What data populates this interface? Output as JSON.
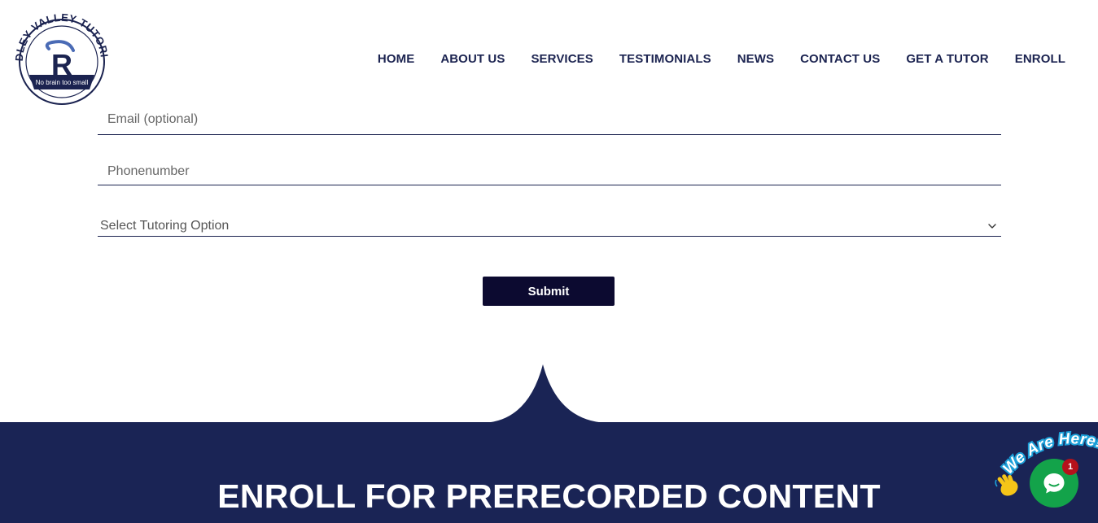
{
  "brand": {
    "name": "RIDLEY VALLEY TUTORIAL",
    "monogram": "R",
    "tagline": "No brain too small",
    "colors": {
      "navy": "#1b2350",
      "band": "#1a2455",
      "button": "#0c0a30",
      "chat": "#13a34a",
      "badge": "#b5121b"
    }
  },
  "nav": {
    "items": [
      {
        "label": "HOME"
      },
      {
        "label": "ABOUT US"
      },
      {
        "label": "SERVICES"
      },
      {
        "label": "TESTIMONIALS"
      },
      {
        "label": "NEWS"
      },
      {
        "label": "CONTACT US"
      },
      {
        "label": "GET A TUTOR"
      },
      {
        "label": "ENROLL"
      }
    ]
  },
  "form": {
    "email_placeholder": "Email (optional)",
    "phone_placeholder": "Phonenumber",
    "select_value": "Select Tutoring Option",
    "submit_label": "Submit"
  },
  "section": {
    "title": "ENROLL FOR PRERECORDED CONTENT"
  },
  "chat": {
    "banner_text": "We Are Here!",
    "badge_count": "1",
    "icons": {
      "hand": "waving-hand-icon",
      "bubble": "chat-bubble-icon"
    }
  }
}
